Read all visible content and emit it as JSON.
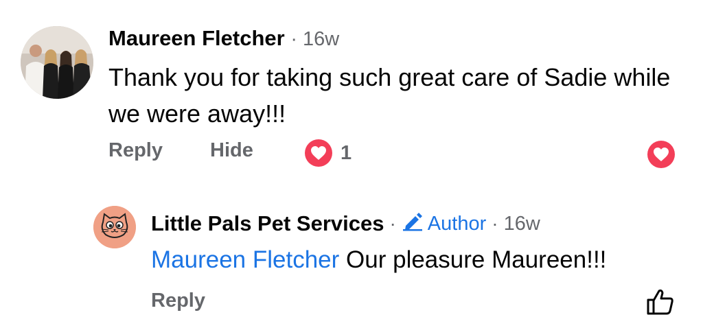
{
  "comment": {
    "author": "Maureen Fletcher",
    "time": "16w",
    "text": "Thank you for taking such great care of Sadie while we were away!!!",
    "actions": {
      "reply": "Reply",
      "hide": "Hide"
    },
    "reaction_count": "1",
    "reaction_icon": "heart-icon",
    "reaction_color": "#f33e58"
  },
  "reply": {
    "author": "Little Pals Pet Services",
    "badge": "Author",
    "badge_icon": "pencil-icon",
    "time": "16w",
    "mention": "Maureen Fletcher",
    "text": "Our pleasure Maureen!!!",
    "action_reply": "Reply",
    "like_icon": "thumbs-up-icon"
  },
  "colors": {
    "link": "#1b74e4",
    "secondary_text": "#65676b",
    "heart": "#f33e58"
  }
}
